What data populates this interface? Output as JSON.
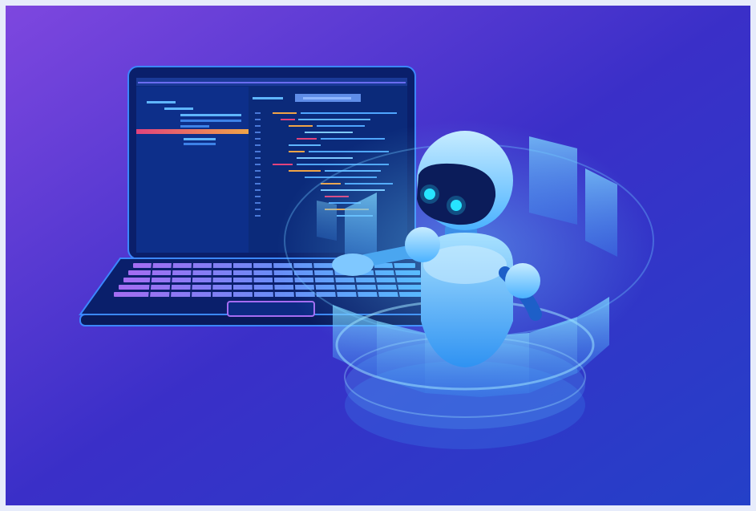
{
  "illustration": {
    "subject": "",
    "background_colors": [
      "#7e47df",
      "#3a2fc8",
      "#2440c8"
    ],
    "frame_color": "#e7ecfb",
    "accent_colors": {
      "highlight_bar": "#f0a447",
      "highlight_bar_start": "#e2437d",
      "screen_bg": "#0b2a7a",
      "robot_body": "#7dd1ff",
      "robot_eye": "#27e4ff",
      "hologram": "#5fc8ff"
    },
    "icons": [
      "laptop-icon",
      "robot-icon",
      "hologram-ring-icon"
    ]
  }
}
